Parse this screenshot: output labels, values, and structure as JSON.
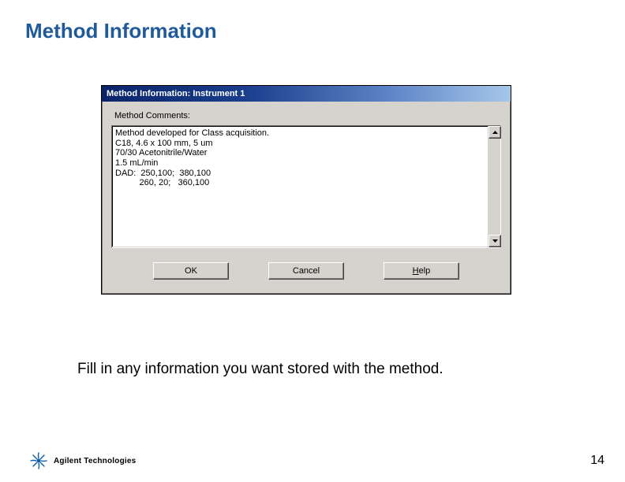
{
  "slide": {
    "title": "Method Information",
    "caption": "Fill in any information you want stored with the method.",
    "page_number": "14"
  },
  "logo": {
    "text": "Agilent Technologies"
  },
  "dialog": {
    "title": "Method Information: Instrument 1",
    "field_label": "Method Comments:",
    "textarea_value": "Method developed for Class acquisition.\nC18, 4.6 x 100 mm, 5 um\n70/30 Acetonitrile/Water\n1.5 mL/min\nDAD:  250,100;  380,100\n          260, 20;   360,100",
    "buttons": {
      "ok": "OK",
      "cancel": "Cancel",
      "help": "Help"
    }
  }
}
